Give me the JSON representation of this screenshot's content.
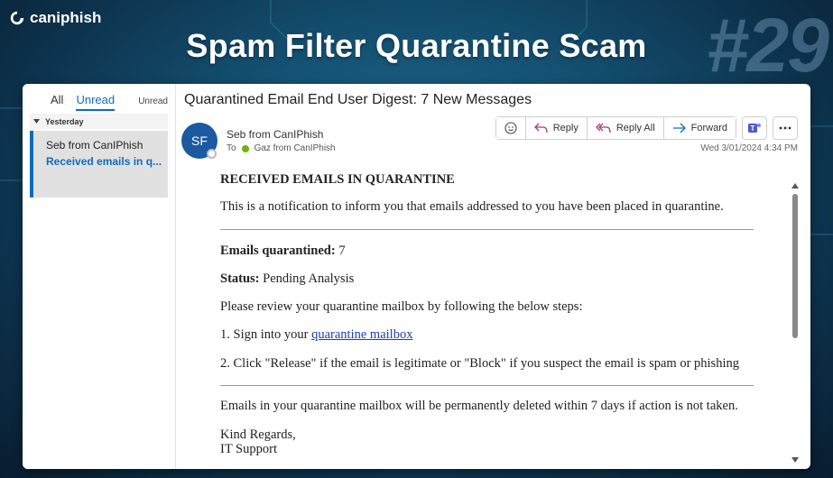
{
  "brand": {
    "name": "caniphish"
  },
  "headline": "Spam Filter Quarantine Scam",
  "episode": "#29",
  "sidebar": {
    "tabs": [
      {
        "label": "All"
      },
      {
        "label": "Unread"
      }
    ],
    "filter_label": "Unread",
    "group_label": "Yesterday",
    "items": [
      {
        "sender": "Seb from CanIPhish",
        "subject": "Received emails in q..."
      }
    ]
  },
  "email": {
    "subject": "Quarantined Email End User Digest: 7 New Messages",
    "avatar_initials": "SF",
    "from": "Seb from CanIPhish",
    "to_label": "To",
    "to": "Gaz from CanIPhish",
    "date": "Wed 3/01/2024 4:34 PM",
    "actions": {
      "reply": "Reply",
      "reply_all": "Reply All",
      "forward": "Forward"
    },
    "body": {
      "heading": "RECEIVED EMAILS IN QUARANTINE",
      "intro": "This is a notification to inform you that emails addressed to you have been placed in quarantine.",
      "count_label": "Emails quarantined:",
      "count_value": " 7",
      "status_label": "Status:",
      "status_value": " Pending Analysis",
      "instructions": "Please review your quarantine mailbox by following the below steps:",
      "step1_prefix": "1. Sign into your ",
      "step1_link": "quarantine mailbox",
      "step2": "2. Click \"Release\" if the email is legitimate or \"Block\" if you suspect the email is spam or phishing",
      "warning": "Emails in your quarantine mailbox will be permanently deleted within 7 days if action is not taken.",
      "signoff": "Kind Regards,",
      "signature": "IT Support"
    }
  },
  "colors": {
    "accent": "#0f6cbd",
    "avatar": "#1b5aa1",
    "background": "#144f70"
  }
}
